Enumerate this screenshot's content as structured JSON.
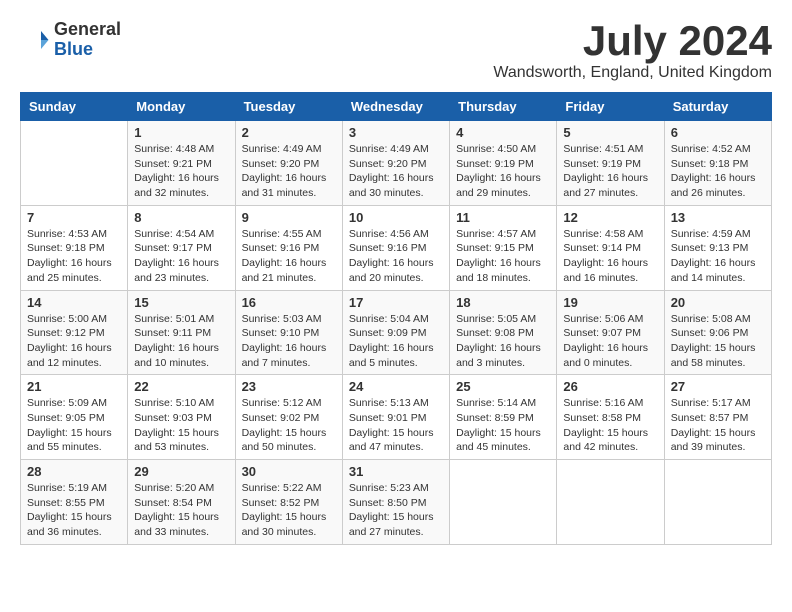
{
  "logo": {
    "general": "General",
    "blue": "Blue"
  },
  "title": {
    "month": "July 2024",
    "location": "Wandsworth, England, United Kingdom"
  },
  "calendar": {
    "headers": [
      "Sunday",
      "Monday",
      "Tuesday",
      "Wednesday",
      "Thursday",
      "Friday",
      "Saturday"
    ],
    "weeks": [
      [
        {
          "day": "",
          "info": ""
        },
        {
          "day": "1",
          "info": "Sunrise: 4:48 AM\nSunset: 9:21 PM\nDaylight: 16 hours\nand 32 minutes."
        },
        {
          "day": "2",
          "info": "Sunrise: 4:49 AM\nSunset: 9:20 PM\nDaylight: 16 hours\nand 31 minutes."
        },
        {
          "day": "3",
          "info": "Sunrise: 4:49 AM\nSunset: 9:20 PM\nDaylight: 16 hours\nand 30 minutes."
        },
        {
          "day": "4",
          "info": "Sunrise: 4:50 AM\nSunset: 9:19 PM\nDaylight: 16 hours\nand 29 minutes."
        },
        {
          "day": "5",
          "info": "Sunrise: 4:51 AM\nSunset: 9:19 PM\nDaylight: 16 hours\nand 27 minutes."
        },
        {
          "day": "6",
          "info": "Sunrise: 4:52 AM\nSunset: 9:18 PM\nDaylight: 16 hours\nand 26 minutes."
        }
      ],
      [
        {
          "day": "7",
          "info": "Sunrise: 4:53 AM\nSunset: 9:18 PM\nDaylight: 16 hours\nand 25 minutes."
        },
        {
          "day": "8",
          "info": "Sunrise: 4:54 AM\nSunset: 9:17 PM\nDaylight: 16 hours\nand 23 minutes."
        },
        {
          "day": "9",
          "info": "Sunrise: 4:55 AM\nSunset: 9:16 PM\nDaylight: 16 hours\nand 21 minutes."
        },
        {
          "day": "10",
          "info": "Sunrise: 4:56 AM\nSunset: 9:16 PM\nDaylight: 16 hours\nand 20 minutes."
        },
        {
          "day": "11",
          "info": "Sunrise: 4:57 AM\nSunset: 9:15 PM\nDaylight: 16 hours\nand 18 minutes."
        },
        {
          "day": "12",
          "info": "Sunrise: 4:58 AM\nSunset: 9:14 PM\nDaylight: 16 hours\nand 16 minutes."
        },
        {
          "day": "13",
          "info": "Sunrise: 4:59 AM\nSunset: 9:13 PM\nDaylight: 16 hours\nand 14 minutes."
        }
      ],
      [
        {
          "day": "14",
          "info": "Sunrise: 5:00 AM\nSunset: 9:12 PM\nDaylight: 16 hours\nand 12 minutes."
        },
        {
          "day": "15",
          "info": "Sunrise: 5:01 AM\nSunset: 9:11 PM\nDaylight: 16 hours\nand 10 minutes."
        },
        {
          "day": "16",
          "info": "Sunrise: 5:03 AM\nSunset: 9:10 PM\nDaylight: 16 hours\nand 7 minutes."
        },
        {
          "day": "17",
          "info": "Sunrise: 5:04 AM\nSunset: 9:09 PM\nDaylight: 16 hours\nand 5 minutes."
        },
        {
          "day": "18",
          "info": "Sunrise: 5:05 AM\nSunset: 9:08 PM\nDaylight: 16 hours\nand 3 minutes."
        },
        {
          "day": "19",
          "info": "Sunrise: 5:06 AM\nSunset: 9:07 PM\nDaylight: 16 hours\nand 0 minutes."
        },
        {
          "day": "20",
          "info": "Sunrise: 5:08 AM\nSunset: 9:06 PM\nDaylight: 15 hours\nand 58 minutes."
        }
      ],
      [
        {
          "day": "21",
          "info": "Sunrise: 5:09 AM\nSunset: 9:05 PM\nDaylight: 15 hours\nand 55 minutes."
        },
        {
          "day": "22",
          "info": "Sunrise: 5:10 AM\nSunset: 9:03 PM\nDaylight: 15 hours\nand 53 minutes."
        },
        {
          "day": "23",
          "info": "Sunrise: 5:12 AM\nSunset: 9:02 PM\nDaylight: 15 hours\nand 50 minutes."
        },
        {
          "day": "24",
          "info": "Sunrise: 5:13 AM\nSunset: 9:01 PM\nDaylight: 15 hours\nand 47 minutes."
        },
        {
          "day": "25",
          "info": "Sunrise: 5:14 AM\nSunset: 8:59 PM\nDaylight: 15 hours\nand 45 minutes."
        },
        {
          "day": "26",
          "info": "Sunrise: 5:16 AM\nSunset: 8:58 PM\nDaylight: 15 hours\nand 42 minutes."
        },
        {
          "day": "27",
          "info": "Sunrise: 5:17 AM\nSunset: 8:57 PM\nDaylight: 15 hours\nand 39 minutes."
        }
      ],
      [
        {
          "day": "28",
          "info": "Sunrise: 5:19 AM\nSunset: 8:55 PM\nDaylight: 15 hours\nand 36 minutes."
        },
        {
          "day": "29",
          "info": "Sunrise: 5:20 AM\nSunset: 8:54 PM\nDaylight: 15 hours\nand 33 minutes."
        },
        {
          "day": "30",
          "info": "Sunrise: 5:22 AM\nSunset: 8:52 PM\nDaylight: 15 hours\nand 30 minutes."
        },
        {
          "day": "31",
          "info": "Sunrise: 5:23 AM\nSunset: 8:50 PM\nDaylight: 15 hours\nand 27 minutes."
        },
        {
          "day": "",
          "info": ""
        },
        {
          "day": "",
          "info": ""
        },
        {
          "day": "",
          "info": ""
        }
      ]
    ]
  }
}
